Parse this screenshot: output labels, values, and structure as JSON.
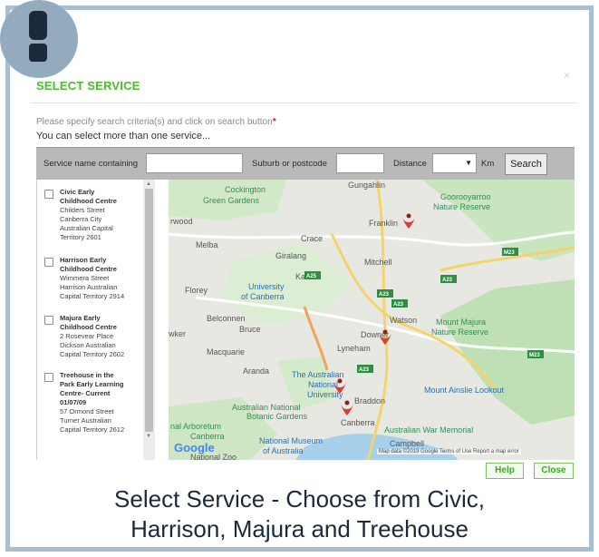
{
  "dialog": {
    "title": "SELECT SERVICE",
    "close_label": "×",
    "instruction": "Please specify search criteria(s) and click on search button",
    "required_mark": "*",
    "multi_note": "You can select more than one service..."
  },
  "search": {
    "name_label": "Service name containing",
    "name_value": "",
    "suburb_label": "Suburb or postcode",
    "suburb_value": "",
    "distance_label": "Distance",
    "distance_value": "",
    "unit_label": "Km",
    "search_button": "Search"
  },
  "services": [
    {
      "name_lines": [
        "Civic Early",
        "Childhood Centre"
      ],
      "address_lines": [
        "Childers Street",
        "Canberra City",
        "Australian Capital",
        "Territory 2601"
      ]
    },
    {
      "name_lines": [
        "Harrison Early",
        "Childhood Centre"
      ],
      "address_lines": [
        "Wimmera Street",
        "Harrison Australian",
        "Capital Territory 2914"
      ]
    },
    {
      "name_lines": [
        "Majura Early",
        "Childhood Centre"
      ],
      "address_lines": [
        "2 Rosevear Place",
        "Dickson Australian",
        "Capital Territory 2602"
      ]
    },
    {
      "name_lines": [
        "Treehouse in the",
        "Park Early Learning",
        "Centre- Current",
        "01/07/09"
      ],
      "address_lines": [
        "57 Ormond Street",
        "Turner Australian",
        "Capital Territory 2612"
      ]
    }
  ],
  "map": {
    "places": [
      "Cockington",
      "Green Gardens",
      "Gungahlin",
      "Goorooyarroo",
      "Nature Reserve",
      "rwood",
      "Crace",
      "Franklin",
      "Melba",
      "Giralang",
      "Kaleen",
      "Mitchell",
      "Florey",
      "University",
      "of Canberra",
      "Belconnen",
      "Bruce",
      "Watson",
      "Mount Majura",
      "Nature Reserve",
      "wker",
      "Macquarie",
      "Lyneham",
      "Downer",
      "Aranda",
      "The Australian",
      "National",
      "University",
      "Braddon",
      "Mount Ainslie Lookout",
      "Australian National",
      "Botanic Gardens",
      "Canberra",
      "Australian War Memorial",
      "nal Arboretum",
      "Canberra",
      "National Museum",
      "of Australia",
      "Campbell",
      "National Zoo"
    ],
    "shields": [
      "A25",
      "A23",
      "A23",
      "M23",
      "A23",
      "M23",
      "A23"
    ],
    "google_logo": "Google",
    "attribution": "Map data ©2019 Google   Terms of Use   Report a map error"
  },
  "footer": {
    "help_button": "Help",
    "close_button": "Close"
  },
  "caption": {
    "line1": "Select Service - Choose from Civic,",
    "line2": "Harrison, Majura and Treehouse"
  },
  "colors": {
    "accent_green": "#4cbb2f",
    "frame_blue": "#a9bfcf",
    "badge_blue": "#94abbd",
    "pin_red": "#d8403a",
    "dark_navy": "#1b2a3a"
  },
  "icons": {
    "badge": "exclamation-icon",
    "pin": "map-pin-icon"
  }
}
